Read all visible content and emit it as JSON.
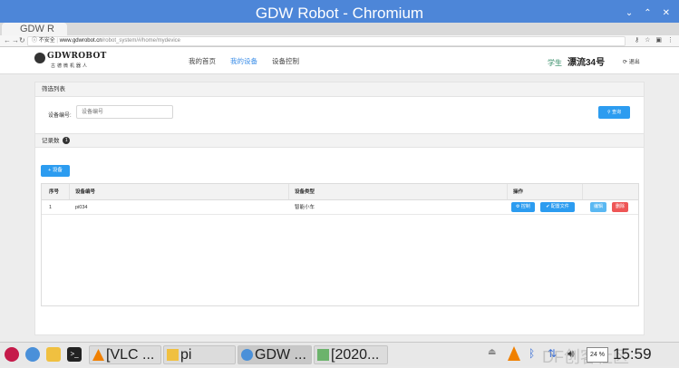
{
  "window": {
    "title": "GDW Robot - Chromium",
    "controls": [
      "⌄",
      "⌃",
      "✕"
    ]
  },
  "browser": {
    "tab_title": "GDW R",
    "security_label": "不安全",
    "url_host": "www.gdwrobot.cn",
    "url_path": "/robot_system/#/home/mydevice"
  },
  "site": {
    "logo_text": "GDWROBOT",
    "logo_subtext": "古德微机器人",
    "nav": [
      {
        "label": "我的首页",
        "active": false
      },
      {
        "label": "我的设备",
        "active": true
      },
      {
        "label": "设备控制",
        "active": false
      }
    ],
    "user_role": "学生",
    "user_name": "漂流34号",
    "logout_label": "退出"
  },
  "filter": {
    "section_title": "筛选列表",
    "device_id_label": "设备编号:",
    "device_id_placeholder": "设备编号",
    "query_button": "查询"
  },
  "records": {
    "section_title": "记录数",
    "count": "1",
    "add_button": "设备",
    "columns": [
      "序号",
      "设备编号",
      "设备类型",
      "操作"
    ],
    "rows": [
      {
        "index": "1",
        "device_id": "pi034",
        "device_type": "智能小车"
      }
    ],
    "row_actions": {
      "control": "控制",
      "config": "配置文件",
      "edit": "编辑",
      "delete": "删除"
    }
  },
  "taskbar": {
    "windows": [
      {
        "label": "[VLC ..."
      },
      {
        "label": "pi"
      },
      {
        "label": "GDW ..."
      },
      {
        "label": "[2020..."
      }
    ],
    "cpu_text": "24 %",
    "clock": "15:59",
    "watermark": "DF创客社区"
  },
  "colors": {
    "titlebar": "#4d86d8",
    "accent": "#2c9cf0",
    "danger": "#ee5656"
  }
}
